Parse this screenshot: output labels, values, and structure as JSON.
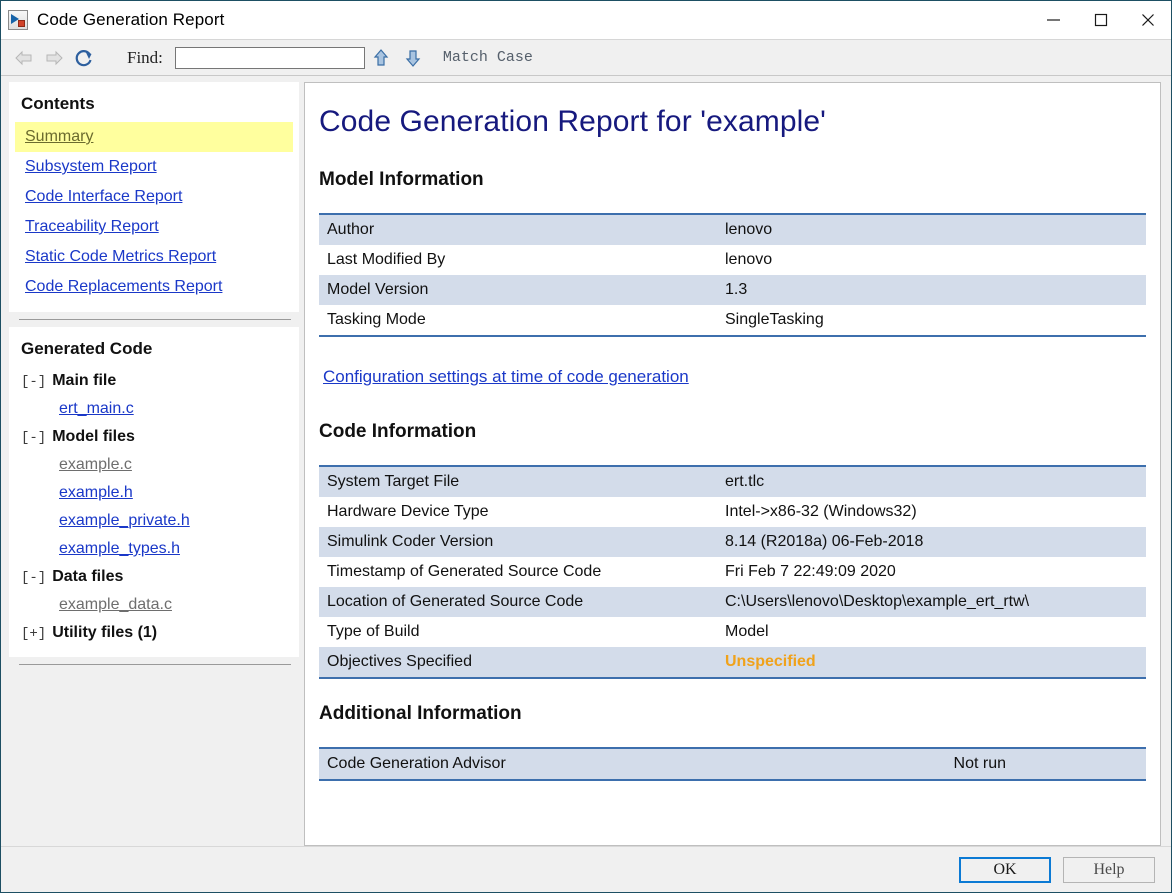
{
  "window": {
    "title": "Code Generation Report",
    "icon": "simulink-icon",
    "controls": [
      {
        "name": "minimize-button",
        "glyph": "minimize"
      },
      {
        "name": "maximize-button",
        "glyph": "maximize"
      },
      {
        "name": "close-button",
        "glyph": "close"
      }
    ]
  },
  "toolbar": {
    "back_icon": "back-arrow-icon",
    "forward_icon": "forward-arrow-icon",
    "refresh_icon": "refresh-icon",
    "find_label": "Find:",
    "find_value": "",
    "find_placeholder": "",
    "find_prev_icon": "find-previous-arrow-icon",
    "find_next_icon": "find-next-arrow-icon",
    "match_case_label": "Match Case"
  },
  "sidebar": {
    "contents_heading": "Contents",
    "links": [
      {
        "label": "Summary",
        "active": true
      },
      {
        "label": "Subsystem Report",
        "active": false
      },
      {
        "label": "Code Interface Report",
        "active": false
      },
      {
        "label": "Traceability Report",
        "active": false
      },
      {
        "label": "Static Code Metrics Report",
        "active": false
      },
      {
        "label": "Code Replacements Report",
        "active": false
      }
    ],
    "generated_heading": "Generated Code",
    "tree": [
      {
        "type": "node",
        "marker": "[-]",
        "label": "Main file"
      },
      {
        "type": "file",
        "label": "ert_main.c",
        "visited": false
      },
      {
        "type": "node",
        "marker": "[-]",
        "label": "Model files"
      },
      {
        "type": "file",
        "label": "example.c",
        "visited": true
      },
      {
        "type": "file",
        "label": "example.h",
        "visited": false
      },
      {
        "type": "file",
        "label": "example_private.h",
        "visited": false
      },
      {
        "type": "file",
        "label": "example_types.h",
        "visited": false
      },
      {
        "type": "node",
        "marker": "[-]",
        "label": "Data files"
      },
      {
        "type": "file",
        "label": "example_data.c",
        "visited": true
      },
      {
        "type": "node",
        "marker": "[+]",
        "label": "Utility files (1)"
      }
    ]
  },
  "report": {
    "title": "Code Generation Report for 'example'",
    "model_information": {
      "heading": "Model Information",
      "rows": [
        {
          "key": "Author",
          "value": "lenovo"
        },
        {
          "key": "Last Modified By",
          "value": "lenovo"
        },
        {
          "key": "Model Version",
          "value": "1.3"
        },
        {
          "key": "Tasking Mode",
          "value": "SingleTasking"
        }
      ]
    },
    "config_link": "Configuration settings at time of code generation",
    "code_information": {
      "heading": "Code Information",
      "rows": [
        {
          "key": "System Target File",
          "value": "ert.tlc"
        },
        {
          "key": "Hardware Device Type",
          "value": "Intel->x86-32 (Windows32)"
        },
        {
          "key": "Simulink Coder Version",
          "value": "8.14 (R2018a) 06-Feb-2018"
        },
        {
          "key": "Timestamp of Generated Source Code",
          "value": "Fri Feb 7 22:49:09 2020"
        },
        {
          "key": "Location of Generated Source Code",
          "value": "C:\\Users\\lenovo\\Desktop\\example_ert_rtw\\"
        },
        {
          "key": "Type of Build",
          "value": "Model"
        },
        {
          "key": "Objectives Specified",
          "value": "Unspecified",
          "warn": true
        }
      ]
    },
    "additional_information": {
      "heading": "Additional Information",
      "rows": [
        {
          "key": "Code Generation Advisor",
          "value": "Not run"
        }
      ]
    }
  },
  "footer": {
    "ok_label": "OK",
    "help_label": "Help"
  },
  "colors": {
    "title_blue": "#16197e",
    "link_blue": "#1a38c8",
    "visited_grey": "#6e6e6e",
    "row_shade": "#d3dcea",
    "table_border": "#3d6fad",
    "highlight_yellow": "#ffff9e",
    "warn_orange": "#f0a21b",
    "focus_blue": "#0b7ad4"
  }
}
